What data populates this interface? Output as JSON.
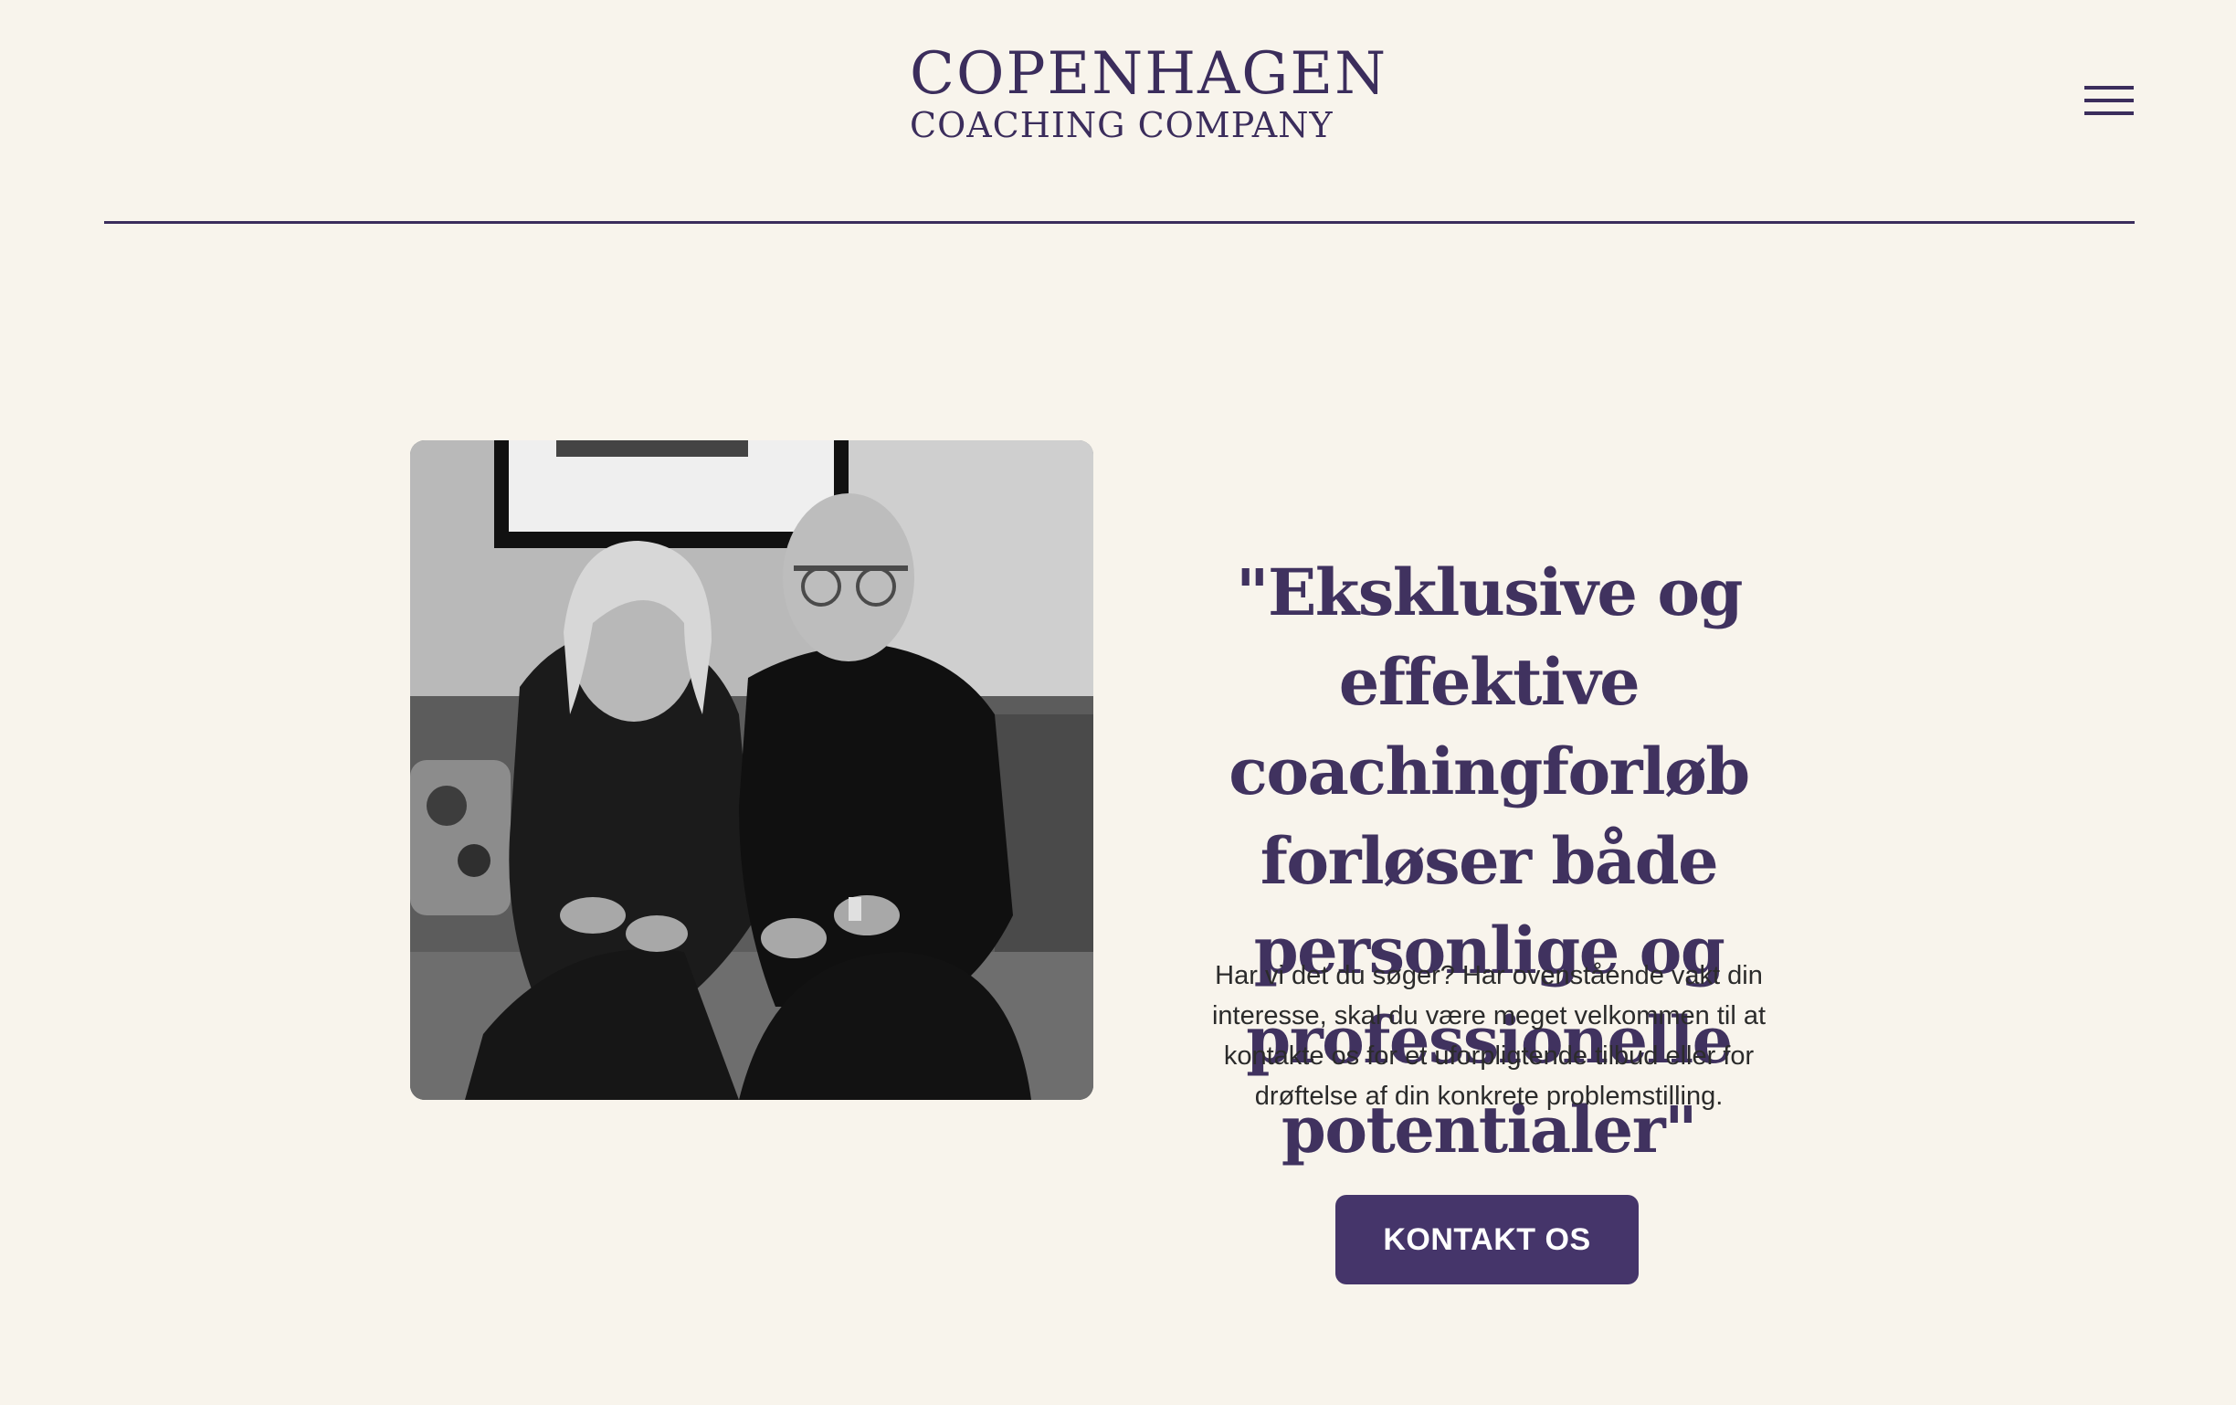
{
  "header": {
    "logo_line1": "COPENHAGEN",
    "logo_line2": "COACHING COMPANY",
    "menu_icon": "hamburger-menu-icon"
  },
  "hero": {
    "photo_icon": "team-photo",
    "quote": "\"Eksklusive og effektive coachingforløb forløser både personlige og professionelle potentialer\"",
    "body": "Har vi det du søger? Har ovenstående vakt din interesse, skal du være meget velkommen til at kontakte os for et uforpligtende tilbud eller for drøftelse af din konkrete problemstilling.",
    "cta_label": "KONTAKT OS"
  },
  "colors": {
    "background": "#f8f4ec",
    "brand": "#3b2d5c",
    "button": "#45356a",
    "button_text": "#ffffff"
  }
}
